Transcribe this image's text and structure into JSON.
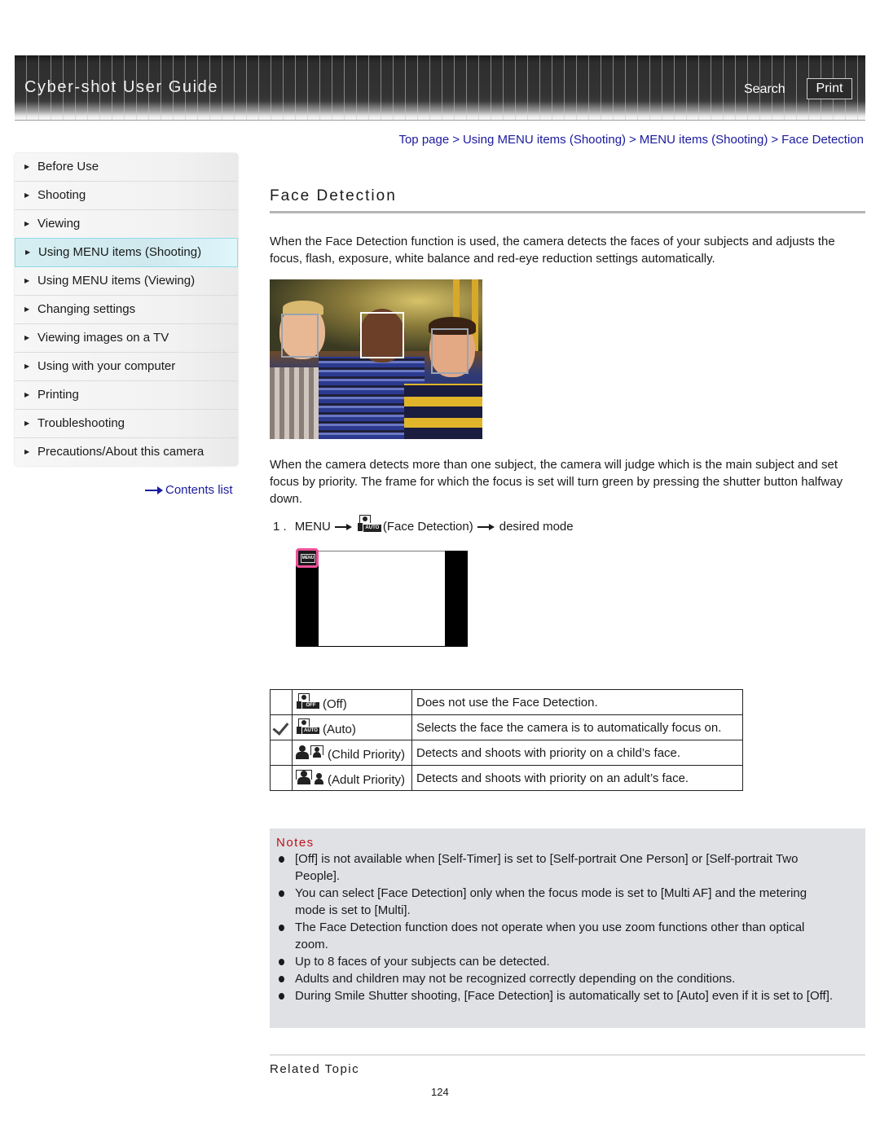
{
  "header": {
    "title": "Cyber-shot User Guide",
    "search_label": "Search",
    "print_label": "Print"
  },
  "breadcrumb": [
    {
      "label": "Top page"
    },
    {
      "label": "Using MENU items (Shooting)"
    },
    {
      "label": "MENU items (Shooting)"
    },
    {
      "label": "Face Detection"
    }
  ],
  "breadcrumb_separator": ">",
  "sidebar": {
    "items": [
      {
        "label": "Before Use",
        "active": false
      },
      {
        "label": "Shooting",
        "active": false
      },
      {
        "label": "Viewing",
        "active": false
      },
      {
        "label": "Using MENU items (Shooting)",
        "active": true
      },
      {
        "label": "Using MENU items (Viewing)",
        "active": false
      },
      {
        "label": "Changing settings",
        "active": false
      },
      {
        "label": "Viewing images on a TV",
        "active": false
      },
      {
        "label": "Using with your computer",
        "active": false
      },
      {
        "label": "Printing",
        "active": false
      },
      {
        "label": "Troubleshooting",
        "active": false
      },
      {
        "label": "Precautions/About this camera",
        "active": false
      }
    ],
    "contents_link": "Contents list"
  },
  "main": {
    "title": "Face Detection",
    "intro": "When the Face Detection function is used, the camera detects the faces of your subjects and adjusts the focus, flash, exposure, white balance and red-eye reduction settings automatically.",
    "photo_alt": "Three smiling children with face detection frames",
    "multi_subject": "When the camera detects more than one subject, the camera will judge which is the main subject and set focus by priority. The frame for which the focus is set will turn green by pressing the shutter button halfway down.",
    "step": {
      "number": "1 .",
      "menu": "MENU",
      "icon": "face-detection-auto-icon",
      "item": "(Face Detection)",
      "target": "desired mode"
    },
    "screen_menu_label": "MENU",
    "modes": [
      {
        "icon": "face-detection-off-icon",
        "icon_tag": "OFF",
        "label": "(Off)",
        "description": "Does not use the Face Detection.",
        "selected": false
      },
      {
        "icon": "face-detection-auto-icon",
        "icon_tag": "AUTO",
        "label": "(Auto)",
        "description": "Selects the face the camera is to automatically focus on.",
        "selected": true
      },
      {
        "icon": "child-priority-icon",
        "label": "(Child Priority)",
        "description": "Detects and shoots with priority on a child’s face.",
        "selected": false
      },
      {
        "icon": "adult-priority-icon",
        "label": "(Adult Priority)",
        "description": "Detects and shoots with priority on an adult’s face.",
        "selected": false
      }
    ],
    "notes": {
      "title": "Notes",
      "items": [
        "[Off] is not available when [Self-Timer] is set to [Self-portrait One Person] or [Self-portrait Two People].",
        "You can select [Face Detection] only when the focus mode is set to [Multi AF] and the metering mode is set to [Multi].",
        "The Face Detection function does not operate when you use zoom functions other than optical zoom.",
        "Up to 8 faces of your subjects can be detected.",
        "Adults and children may not be recognized correctly depending on the conditions.",
        "During Smile Shutter shooting, [Face Detection] is automatically set to [Auto] even if it is set to [Off]."
      ]
    },
    "related_topic": "Related Topic",
    "page_number": "124"
  },
  "colors": {
    "link": "#1a1a9e",
    "notes_title": "#c0101a",
    "notes_bg": "#dfe1e5",
    "active_nav": "#d5eef2",
    "menu_highlight": "#f0509a"
  }
}
